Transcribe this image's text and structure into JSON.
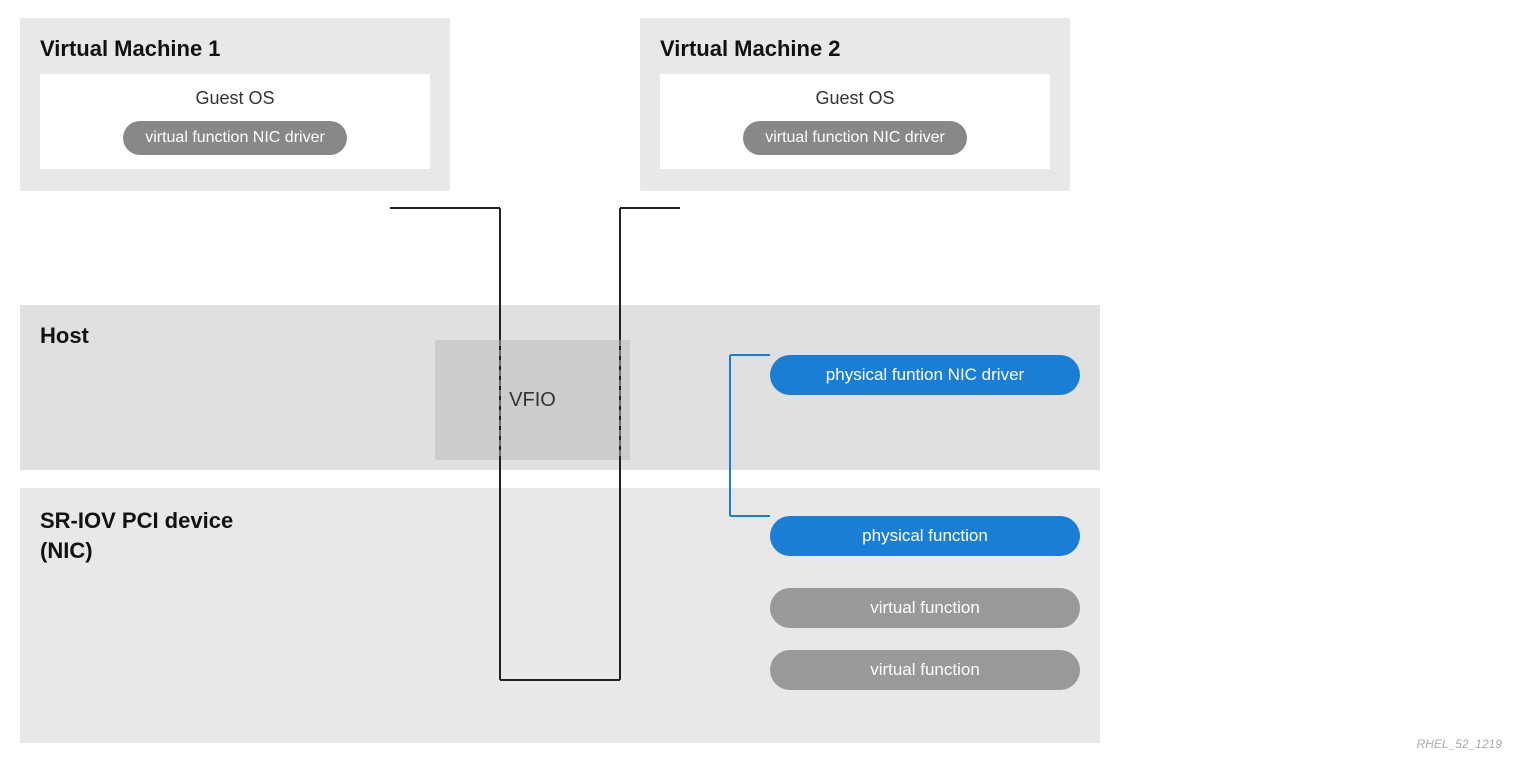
{
  "vm1": {
    "title": "Virtual Machine 1",
    "guest_os_label": "Guest OS",
    "vf_nic_label": "virtual function NIC driver"
  },
  "vm2": {
    "title": "Virtual Machine 2",
    "guest_os_label": "Guest OS",
    "vf_nic_label": "virtual function NIC driver"
  },
  "host": {
    "title": "Host",
    "vfio_label": "VFIO",
    "pf_nic_label": "physical funtion NIC driver"
  },
  "sriov": {
    "title_line1": "SR-IOV PCI device",
    "title_line2": "(NIC)",
    "pf_label": "physical function",
    "vf1_label": "virtual function",
    "vf2_label": "virtual function"
  },
  "watermark": "RHEL_52_1219"
}
